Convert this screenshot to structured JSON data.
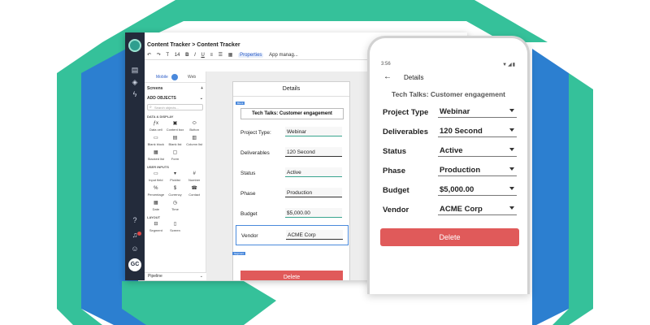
{
  "colors": {
    "hex_green": "#35c19a",
    "hex_blue": "#2c7fd0",
    "accent": "#4a89dc",
    "delete": "#e05a5a"
  },
  "desktop": {
    "breadcrumb": "Content Tracker  >  Content Tracker",
    "toolbar": {
      "font_label": "T",
      "size_label": "14",
      "bold": "B",
      "italic": "I",
      "underline": "U",
      "properties_label": "Properties",
      "app_manager_label": "App manag..."
    },
    "left_panel": {
      "tab_mobile": "Mobile",
      "tab_web": "Web",
      "screens_label": "Screens",
      "add_objects_label": "ADD OBJECTS",
      "search_placeholder": "Search objects...",
      "data_display_label": "DATA & DISPLAY",
      "data_items": [
        "Data cell",
        "Content box",
        "Button",
        "Blank block",
        "Blank list",
        "Column list",
        "Stacked list",
        "Form"
      ],
      "user_inputs_label": "USER INPUTS",
      "input_items": [
        "Input field",
        "Picklist",
        "Number",
        "Percentage",
        "Currency",
        "Contact",
        "Date",
        "Time"
      ],
      "layout_label": "LAYOUT",
      "layout_items": [
        "Segment",
        "Screen"
      ],
      "pipeline_label": "Pipeline"
    },
    "rail": {
      "avatar_initials": "GC"
    },
    "preview": {
      "header": "Details",
      "block_tag": "Block",
      "title": "Tech Talks: Customer engagement",
      "rows": [
        {
          "label": "Project Type:",
          "value": "Webinar"
        },
        {
          "label": "Deliverables",
          "value": "120 Second"
        },
        {
          "label": "Status",
          "value": "Active"
        },
        {
          "label": "Phase",
          "value": "Production"
        },
        {
          "label": "Budget",
          "value": "$5,000.00"
        },
        {
          "label": "Vendor",
          "value": "ACME Corp"
        }
      ],
      "segment_tag": "Segment",
      "delete_label": "Delete"
    }
  },
  "phone": {
    "time": "3:56",
    "status_icons": "▼◢▮",
    "app_title": "Details",
    "title": "Tech Talks: Customer engagement",
    "rows": [
      {
        "label": "Project Type",
        "value": "Webinar"
      },
      {
        "label": "Deliverables",
        "value": "120 Second"
      },
      {
        "label": "Status",
        "value": "Active"
      },
      {
        "label": "Phase",
        "value": "Production"
      },
      {
        "label": "Budget",
        "value": "$5,000.00"
      },
      {
        "label": "Vendor",
        "value": "ACME Corp"
      }
    ],
    "delete_label": "Delete"
  }
}
